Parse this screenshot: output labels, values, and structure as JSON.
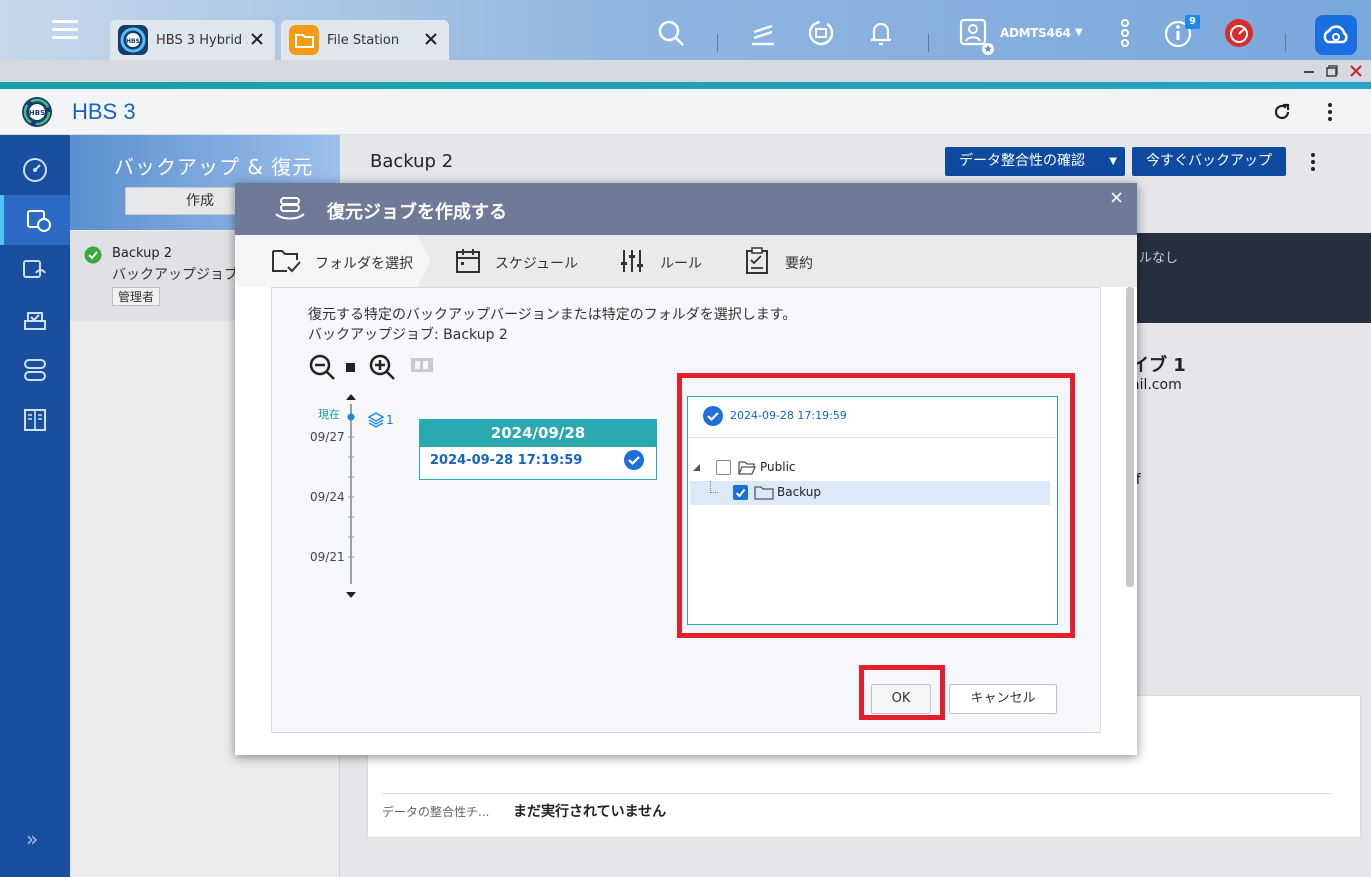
{
  "topbar": {
    "tabs": [
      {
        "label": "HBS 3 Hybrid ...",
        "icon": "hbs-app-icon",
        "color": "#1a3a6e"
      },
      {
        "label": "File Station",
        "icon": "folder-app-icon",
        "color": "#f39c12"
      }
    ],
    "user": "ADMTS464",
    "notification_count": "9"
  },
  "app": {
    "title": "HBS 3"
  },
  "nav": {
    "items": [
      "overview-icon",
      "backup-restore-icon",
      "sync-icon",
      "storage-icon",
      "services-icon",
      "logs-icon"
    ],
    "expand": "»"
  },
  "column": {
    "title": "バックアップ & 復元",
    "create_button": "作成",
    "job": {
      "name": "Backup 2",
      "type": "バックアップジョブ",
      "owner": "管理者"
    }
  },
  "main": {
    "title": "Backup 2",
    "integrity_button": "データ整合性の確認",
    "backup_now_button": "今すぐバックアップ",
    "info_text": "ルなし",
    "side_title": "イブ 1",
    "side_email": "ail.com",
    "side_status": "ff",
    "integrity_label": "データの整合性チ...",
    "integrity_value": "まだ実行されていません"
  },
  "modal": {
    "title": "復元ジョブを作成する",
    "steps": [
      "フォルダを選択",
      "スケジュール",
      "ルール",
      "要約"
    ],
    "description": "復元する特定のバックアップバージョンまたは特定のフォルダを選択します。",
    "job_label": "バックアップジョブ: Backup 2",
    "timeline": {
      "now_label": "現在",
      "dates": [
        "09/27",
        "09/24",
        "09/21"
      ],
      "version_count": "1"
    },
    "version_card": {
      "date": "2024/09/28",
      "time": "2024-09-28 17:19:59"
    },
    "tree": {
      "header": "2024-09-28 17:19:59",
      "items": [
        {
          "label": "Public",
          "checked": false
        },
        {
          "label": "Backup",
          "checked": true
        }
      ]
    },
    "ok_button": "OK",
    "cancel_button": "キャンセル"
  },
  "colors": {
    "accent_blue": "#0d4aa0",
    "teal": "#2aa9b0",
    "highlight_red": "#e5202a"
  }
}
